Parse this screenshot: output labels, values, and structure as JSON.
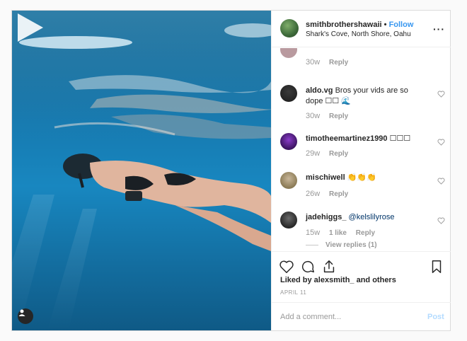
{
  "header": {
    "username": "smithbrothershawaii",
    "separator": "•",
    "follow_label": "Follow",
    "location": "Shark's Cove, North Shore, Oahu",
    "more_label": "···"
  },
  "comments": [
    {
      "username": "",
      "text": "",
      "age": "30w",
      "likes": "",
      "reply_label": "Reply"
    },
    {
      "username": "aldo.vg",
      "text": "Bros your vids are so dope ☐☐ 🌊",
      "age": "30w",
      "likes": "",
      "reply_label": "Reply"
    },
    {
      "username": "timotheemartinez1990",
      "text": "☐☐☐",
      "age": "29w",
      "likes": "",
      "reply_label": "Reply"
    },
    {
      "username": "mischiwell",
      "text": "👏👏👏",
      "age": "26w",
      "likes": "",
      "reply_label": "Reply"
    },
    {
      "username": "jadehiggs_",
      "text": "@kelslilyrose",
      "age": "15w",
      "likes": "1 like",
      "reply_label": "Reply",
      "view_replies": "View replies (1)"
    }
  ],
  "actions": {
    "liked_by": "Liked by alexsmith_ and others",
    "date": "APRIL 11"
  },
  "add_comment": {
    "placeholder": "Add a comment...",
    "post_label": "Post"
  },
  "colors": {
    "follow": "#3897f0",
    "mention": "#003569",
    "post_disabled": "#b3dbff",
    "water": "#167ab0"
  },
  "icons": [
    "play-icon",
    "user-tag-icon",
    "heart-icon",
    "comment-icon",
    "share-icon",
    "bookmark-icon",
    "more-icon"
  ]
}
